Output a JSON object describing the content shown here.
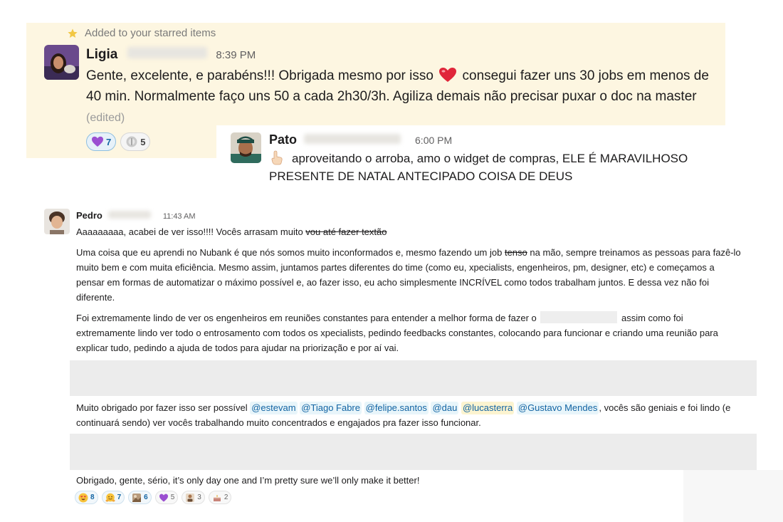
{
  "starred": {
    "text": "Added to your starred items"
  },
  "messages": {
    "ligia": {
      "author": "Ligia",
      "time": "8:39 PM",
      "text_before_heart": "Gente, excelente, e parabéns!!! Obrigada mesmo por isso ",
      "text_after_heart": " consegui fazer uns 30 jobs em menos de 40 min. Normalmente faço uns 50 a cada 2h30/3h. Agiliza demais não precisar puxar o doc na master ",
      "edited": "(edited)",
      "reactions": [
        {
          "icon": "purple-heart-icon",
          "count": "7"
        },
        {
          "icon": "award-icon",
          "count": "5"
        }
      ]
    },
    "pato": {
      "author": "Pato",
      "time": "6:00 PM",
      "text": "aproveitando o arroba, amo o widget de compras, ELE É MARAVILHOSO PRESENTE DE NATAL ANTECIPADO COISA DE DEUS"
    },
    "pedro": {
      "author": "Pedro",
      "time": "11:43 AM",
      "p1_text": "Aaaaaaaaa, acabei de ver isso!!!! Vocês arrasam muito ",
      "p1_strike": "vou até fazer textão",
      "p2_a": "Uma coisa que eu aprendi no Nubank é que nós somos muito inconformados e, mesmo fazendo um job ",
      "p2_strike": "tenso",
      "p2_b": " na mão, sempre treinamos as pessoas para fazê-lo muito bem e com muita eficiência. Mesmo assim, juntamos partes diferentes do time (como eu, xpecialists, engenheiros, pm, designer, etc) e começamos a pensar em formas de automatizar o máximo possível e, ao fazer isso, eu acho simplesmente INCRÍVEL como todos trabalham juntos. E dessa vez não foi diferente.",
      "p3_a": "Foi extremamente lindo de ver os engenheiros em reuniões constantes para entender a melhor forma de fazer o ",
      "p3_b": " assim como foi extremamente lindo ver todo o entrosamento com todos os xpecialists, pedindo feedbacks constantes, colocando para funcionar e criando uma reunião para explicar tudo, pedindo a ajuda de todos para ajudar na priorização e por aí vai.",
      "p4_a": "Muito obrigado por fazer isso ser possível ",
      "mentions": [
        "@estevam",
        "@Tiago Fabre",
        "@felipe.santos",
        "@dau",
        "@lucasterra",
        "@Gustavo Mendes"
      ],
      "p4_b": ", vocês são geniais e foi lindo (e continuará sendo) ver vocês trabalhando muito concentrados e engajados pra fazer isso funcionar.",
      "p5": "Obrigado, gente, sério, it’s only day one and I’m pretty sure we’ll only make it better!",
      "reactions": [
        {
          "icon": "heart-eyes-icon",
          "count": "8"
        },
        {
          "icon": "hugging-face-icon",
          "count": "7"
        },
        {
          "icon": "custom-image-icon",
          "count": "6"
        },
        {
          "icon": "purple-heart-icon",
          "count": "5"
        },
        {
          "icon": "custom-person-icon",
          "count": "3"
        },
        {
          "icon": "custom-cake-icon",
          "count": "2"
        }
      ]
    }
  },
  "colors": {
    "starred_bg": "#fdf6e1",
    "mention_text": "#1264a3",
    "mention_bg": "#e8f5fa",
    "self_mention_bg": "#fcf4d0",
    "star": "#f2c744"
  }
}
